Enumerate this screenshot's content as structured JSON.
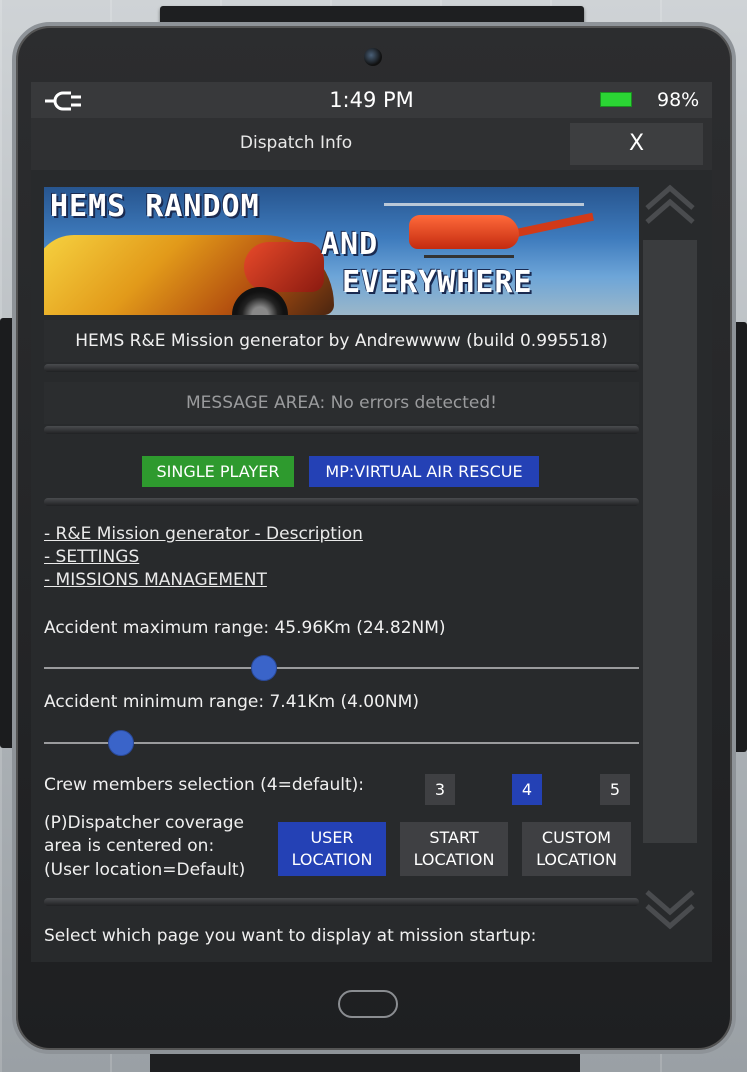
{
  "status_bar": {
    "time": "1:49 PM",
    "battery": "98%"
  },
  "header": {
    "title": "Dispatch Info",
    "close_label": "X"
  },
  "banner": {
    "line1": "HEMS RANDOM",
    "line2": "AND",
    "line3": "EVERYWHERE"
  },
  "generator_info": "HEMS R&E Mission generator by Andrewwww (build 0.995518)",
  "message_area": "MESSAGE AREA: No errors detected!",
  "mode_buttons": {
    "single_player": "SINGLE PLAYER",
    "multiplayer": "MP:VIRTUAL AIR RESCUE"
  },
  "links": {
    "description": "- R&E Mission generator - Description",
    "settings": "- SETTINGS",
    "missions": "- MISSIONS MANAGEMENT"
  },
  "max_range": {
    "label": "Accident maximum range: 45.96Km (24.82NM)",
    "value_fraction": 0.37
  },
  "min_range": {
    "label": "Accident minimum range: 7.41Km (4.00NM)",
    "value_fraction": 0.13
  },
  "crew": {
    "label": "Crew members selection (4=default):",
    "options": [
      "3",
      "4",
      "5"
    ],
    "selected": "4"
  },
  "coverage": {
    "label_line1": "(P)Dispatcher coverage",
    "label_line2": "area is centered on:",
    "label_line3": "(User location=Default)",
    "user_location": [
      "USER",
      "LOCATION"
    ],
    "start_location": [
      "START",
      "LOCATION"
    ],
    "custom_location": [
      "CUSTOM",
      "LOCATION"
    ]
  },
  "startup_page_label": "Select which page you want to display at mission startup:",
  "colors": {
    "selected_blue": "#2441b5",
    "single_player_green": "#2e9a2e",
    "battery_green": "#2bd534"
  }
}
